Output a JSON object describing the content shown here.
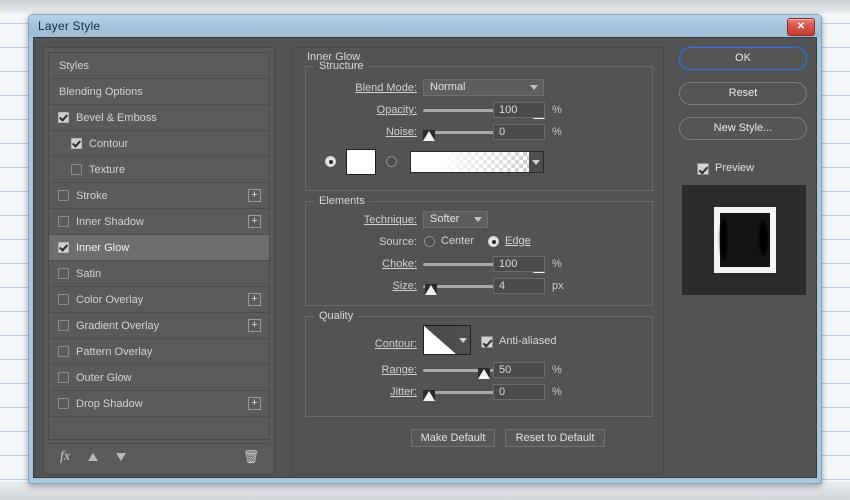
{
  "window": {
    "title": "Layer Style",
    "close_label": "✕",
    "close_icon": "close-icon"
  },
  "styles_panel": {
    "items": [
      {
        "label": "Styles",
        "type": "plain",
        "checked": false,
        "indent": false,
        "selected": false,
        "plus": false
      },
      {
        "label": "Blending Options",
        "type": "plain",
        "checked": false,
        "indent": false,
        "selected": false,
        "plus": false
      },
      {
        "label": "Bevel & Emboss",
        "type": "check",
        "checked": true,
        "indent": false,
        "selected": false,
        "plus": false
      },
      {
        "label": "Contour",
        "type": "check",
        "checked": true,
        "indent": true,
        "selected": false,
        "plus": false
      },
      {
        "label": "Texture",
        "type": "check",
        "checked": false,
        "indent": true,
        "selected": false,
        "plus": false
      },
      {
        "label": "Stroke",
        "type": "check",
        "checked": false,
        "indent": false,
        "selected": false,
        "plus": true
      },
      {
        "label": "Inner Shadow",
        "type": "check",
        "checked": false,
        "indent": false,
        "selected": false,
        "plus": true
      },
      {
        "label": "Inner Glow",
        "type": "check",
        "checked": true,
        "indent": false,
        "selected": true,
        "plus": false
      },
      {
        "label": "Satin",
        "type": "check",
        "checked": false,
        "indent": false,
        "selected": false,
        "plus": false
      },
      {
        "label": "Color Overlay",
        "type": "check",
        "checked": false,
        "indent": false,
        "selected": false,
        "plus": true
      },
      {
        "label": "Gradient Overlay",
        "type": "check",
        "checked": false,
        "indent": false,
        "selected": false,
        "plus": true
      },
      {
        "label": "Pattern Overlay",
        "type": "check",
        "checked": false,
        "indent": false,
        "selected": false,
        "plus": false
      },
      {
        "label": "Outer Glow",
        "type": "check",
        "checked": false,
        "indent": false,
        "selected": false,
        "plus": false
      },
      {
        "label": "Drop Shadow",
        "type": "check",
        "checked": false,
        "indent": false,
        "selected": false,
        "plus": true
      }
    ],
    "plus_label": "+",
    "tools": {
      "fx_label": "fx",
      "fx_icon": "fx-icon",
      "move_up_icon": "arrow-up-icon",
      "move_down_icon": "arrow-down-icon",
      "delete_label": "🗑",
      "delete_icon": "trash-icon"
    }
  },
  "effect": {
    "title": "Inner Glow",
    "structure": {
      "legend": "Structure",
      "blend_mode_label": "Blend Mode:",
      "blend_mode_value": "Normal",
      "opacity_label": "Opacity:",
      "opacity_value": "100",
      "opacity_unit": "%",
      "opacity_percent": 100,
      "noise_label": "Noise:",
      "noise_value": "0",
      "noise_unit": "%",
      "noise_percent": 0,
      "fill_type": "color",
      "color_value": "#ffffff",
      "gradient_from": "#ffffff",
      "gradient_to": "transparent"
    },
    "elements": {
      "legend": "Elements",
      "technique_label": "Technique:",
      "technique_value": "Softer",
      "source_label": "Source:",
      "source_center_label": "Center",
      "source_edge_label": "Edge",
      "source_value": "Edge",
      "choke_label": "Choke:",
      "choke_value": "100",
      "choke_unit": "%",
      "choke_percent": 100,
      "size_label": "Size:",
      "size_value": "4",
      "size_unit": "px",
      "size_percent": 4
    },
    "quality": {
      "legend": "Quality",
      "contour_label": "Contour:",
      "anti_aliased_label": "Anti-aliased",
      "anti_aliased": true,
      "range_label": "Range:",
      "range_value": "50",
      "range_unit": "%",
      "range_percent": 50,
      "jitter_label": "Jitter:",
      "jitter_value": "0",
      "jitter_unit": "%",
      "jitter_percent": 0
    },
    "make_default_label": "Make Default",
    "reset_to_default_label": "Reset to Default"
  },
  "actions": {
    "ok_label": "OK",
    "reset_label": "Reset",
    "new_style_label": "New Style...",
    "preview_label": "Preview",
    "preview_checked": true
  },
  "colors": {
    "dialog_body": "#535353",
    "panel": "#5a5a5a",
    "selection": "#6e6e6e",
    "titlebar": "#a4c2da",
    "focus_ring": "#2f72d8",
    "close_button": "#c23c31",
    "text": "#d2d2d2"
  }
}
